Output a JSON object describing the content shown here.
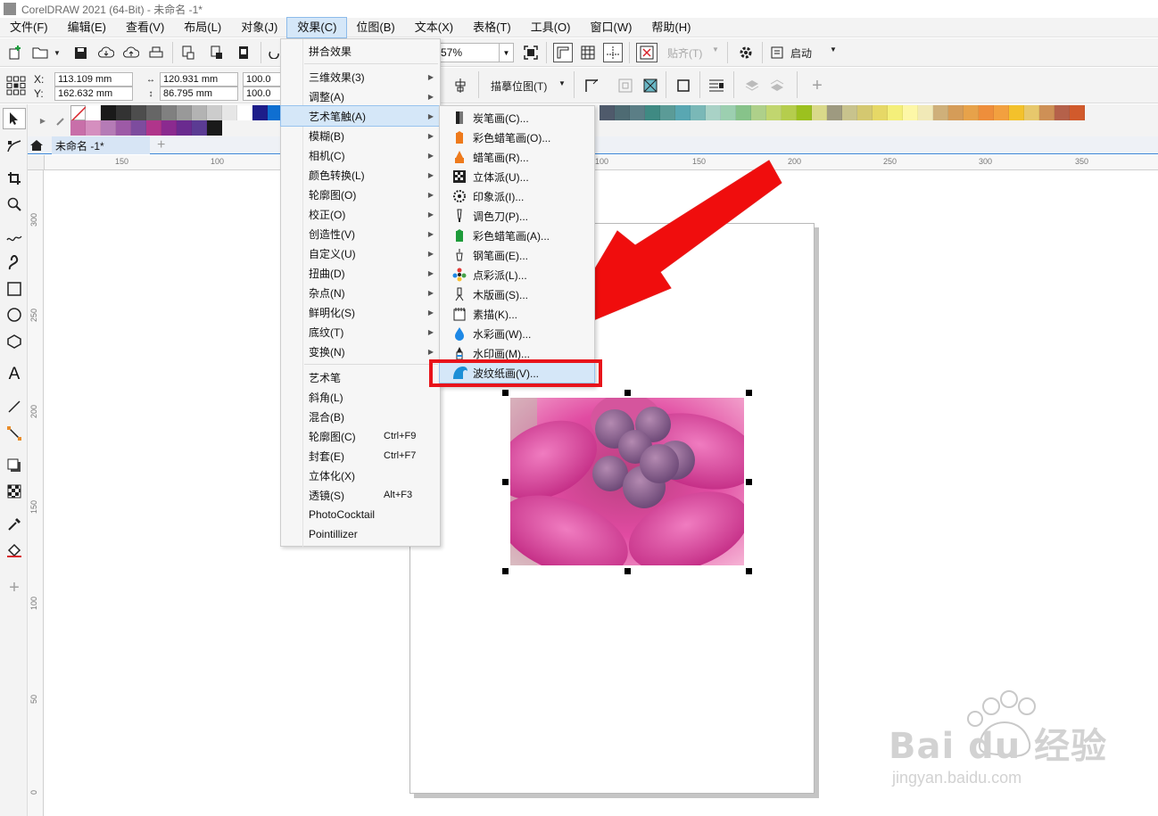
{
  "window": {
    "title": "CorelDRAW 2021 (64-Bit) - 未命名 -1*"
  },
  "menubar": [
    {
      "label": "文件(F)"
    },
    {
      "label": "编辑(E)"
    },
    {
      "label": "查看(V)"
    },
    {
      "label": "布局(L)"
    },
    {
      "label": "对象(J)"
    },
    {
      "label": "效果(C)"
    },
    {
      "label": "位图(B)"
    },
    {
      "label": "文本(X)"
    },
    {
      "label": "表格(T)"
    },
    {
      "label": "工具(O)"
    },
    {
      "label": "窗口(W)"
    },
    {
      "label": "帮助(H)"
    }
  ],
  "toolbar": {
    "zoom": "57%",
    "align_label": "贴齐(T)",
    "launch_label": "启动",
    "trace_label": "描摹位图(T)"
  },
  "properties": {
    "x_label": "X:",
    "y_label": "Y:",
    "x_value": "113.109 mm",
    "y_value": "162.632 mm",
    "width_value": "120.931 mm",
    "height_value": "86.795 mm",
    "scale_x": "100.0",
    "scale_y": "100.0"
  },
  "tabs": {
    "document": "未命名 -1*"
  },
  "ruler": {
    "h_ticks": [
      "150",
      "100",
      "100",
      "150",
      "200",
      "250",
      "300",
      "350"
    ],
    "v_ticks": [
      "300",
      "250",
      "200",
      "150",
      "100",
      "50",
      "0"
    ]
  },
  "effects_menu": {
    "items": [
      {
        "label": "拼合效果",
        "submenu": false,
        "shortcut": ""
      },
      {
        "label": "三维效果(3)",
        "submenu": true,
        "shortcut": ""
      },
      {
        "label": "调整(A)",
        "submenu": true,
        "shortcut": ""
      },
      {
        "label": "艺术笔触(A)",
        "submenu": true,
        "shortcut": "",
        "highlighted": true
      },
      {
        "label": "模糊(B)",
        "submenu": true,
        "shortcut": ""
      },
      {
        "label": "相机(C)",
        "submenu": true,
        "shortcut": ""
      },
      {
        "label": "颜色转换(L)",
        "submenu": true,
        "shortcut": ""
      },
      {
        "label": "轮廓图(O)",
        "submenu": true,
        "shortcut": ""
      },
      {
        "label": "校正(O)",
        "submenu": true,
        "shortcut": ""
      },
      {
        "label": "创造性(V)",
        "submenu": true,
        "shortcut": ""
      },
      {
        "label": "自定义(U)",
        "submenu": true,
        "shortcut": ""
      },
      {
        "label": "扭曲(D)",
        "submenu": true,
        "shortcut": ""
      },
      {
        "label": "杂点(N)",
        "submenu": true,
        "shortcut": ""
      },
      {
        "label": "鲜明化(S)",
        "submenu": true,
        "shortcut": ""
      },
      {
        "label": "底纹(T)",
        "submenu": true,
        "shortcut": ""
      },
      {
        "label": "变换(N)",
        "submenu": true,
        "shortcut": ""
      },
      {
        "label": "艺术笔",
        "submenu": false,
        "shortcut": ""
      },
      {
        "label": "斜角(L)",
        "submenu": false,
        "shortcut": ""
      },
      {
        "label": "混合(B)",
        "submenu": false,
        "shortcut": ""
      },
      {
        "label": "轮廓图(C)",
        "submenu": false,
        "shortcut": "Ctrl+F9"
      },
      {
        "label": "封套(E)",
        "submenu": false,
        "shortcut": "Ctrl+F7"
      },
      {
        "label": "立体化(X)",
        "submenu": false,
        "shortcut": ""
      },
      {
        "label": "透镜(S)",
        "submenu": false,
        "shortcut": "Alt+F3"
      },
      {
        "label": "PhotoCocktail",
        "submenu": false,
        "shortcut": ""
      },
      {
        "label": "Pointillizer",
        "submenu": false,
        "shortcut": ""
      }
    ]
  },
  "art_strokes_submenu": {
    "items": [
      {
        "label": "炭笔画(C)...",
        "icon": "charcoal-icon"
      },
      {
        "label": "彩色蜡笔画(O)...",
        "icon": "conte-crayon-icon"
      },
      {
        "label": "蜡笔画(R)...",
        "icon": "crayon-icon"
      },
      {
        "label": "立体派(U)...",
        "icon": "cubist-icon"
      },
      {
        "label": "印象派(I)...",
        "icon": "impressionist-icon"
      },
      {
        "label": "调色刀(P)...",
        "icon": "palette-knife-icon"
      },
      {
        "label": "彩色蜡笔画(A)...",
        "icon": "pastels-icon"
      },
      {
        "label": "钢笔画(E)...",
        "icon": "pen-ink-icon"
      },
      {
        "label": "点彩派(L)...",
        "icon": "pointillist-icon"
      },
      {
        "label": "木版画(S)...",
        "icon": "scraperboard-icon"
      },
      {
        "label": "素描(K)...",
        "icon": "sketch-pad-icon"
      },
      {
        "label": "水彩画(W)...",
        "icon": "watercolor-icon"
      },
      {
        "label": "水印画(M)...",
        "icon": "water-marker-icon"
      },
      {
        "label": "波纹纸画(V)...",
        "icon": "wave-paper-icon"
      }
    ]
  },
  "palette": {
    "row1": [
      "#ffffff",
      "#1a1a1a",
      "#333333",
      "#4d4d4d",
      "#666666",
      "#808080",
      "#999999",
      "#b3b3b3",
      "#cccccc",
      "#e6e6e6",
      "#ffffff",
      "#1d1d8a",
      "#0f6fd1"
    ],
    "row2": [
      "#c86fa9",
      "#d58fbf",
      "#b57bb6",
      "#9d5aa6",
      "#7d4c9e",
      "#b0358b",
      "#8b2a8f",
      "#6a2b8f",
      "#5b3b93",
      "#1a1a1a"
    ],
    "right": [
      "#4f5a6b",
      "#4e6b73",
      "#5b7e86",
      "#3f8a83",
      "#5b9b97",
      "#59a7b2",
      "#7ab8b7",
      "#a9d2c6",
      "#9ccfb0",
      "#87c38a",
      "#aed08a",
      "#c1d66f",
      "#b5cd4d",
      "#9cc11f",
      "#d9d98a",
      "#9e9a80",
      "#c8c38d",
      "#d4c870",
      "#e6d866",
      "#f4ef7a",
      "#fdf7a7",
      "#f1e9b7",
      "#cfb07a",
      "#d59c58",
      "#e7a24a",
      "#ee8e3b",
      "#f2a03f",
      "#f3c12b",
      "#e7c86c",
      "#ce9056",
      "#b5614a",
      "#d15a2c"
    ]
  },
  "colors": {
    "accent": "#e8131a",
    "menu_highlight": "#d5e7f8",
    "ruler_blue": "#3b86d6"
  },
  "watermark": {
    "brand": "Bai du 经验",
    "url": "jingyan.baidu.com"
  }
}
